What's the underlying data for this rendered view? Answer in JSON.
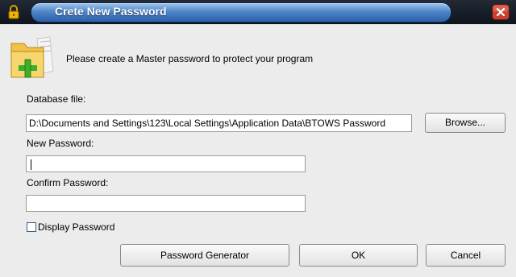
{
  "window": {
    "title": "Crete New Password",
    "intro": "Please create a Master password to protect your program"
  },
  "icons": {
    "title_icon": "lock-icon",
    "close": "close-icon",
    "header": "folder-add-icon"
  },
  "form": {
    "database_label": "Database file:",
    "database_value": "D:\\Documents and Settings\\123\\Local Settings\\Application Data\\BTOWS Password",
    "new_password_label": "New Password:",
    "new_password_value": "",
    "confirm_password_label": "Confirm Password:",
    "confirm_password_value": "",
    "display_password_label": "Display Password",
    "display_password_checked": false
  },
  "buttons": {
    "browse": "Browse...",
    "generator": "Password Generator",
    "ok": "OK",
    "cancel": "Cancel"
  },
  "colors": {
    "title_bar": "#0f141c",
    "title_tab": "#4f87c8",
    "close_button": "#c0392b",
    "background": "#ececec"
  }
}
